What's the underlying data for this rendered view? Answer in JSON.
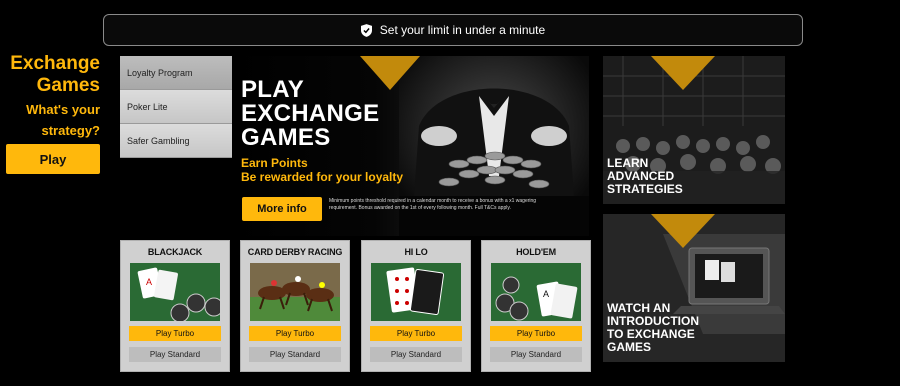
{
  "banner": {
    "text": "Set your limit in under a minute",
    "icon": "shield-check-icon"
  },
  "left": {
    "title_line1": "Exchange",
    "title_line2": "Games",
    "subtitle_line1": "What's your",
    "subtitle_line2": "strategy?",
    "play_label": "Play"
  },
  "menu": {
    "items": [
      {
        "label": "Loyalty Program"
      },
      {
        "label": "Poker Lite"
      },
      {
        "label": "Safer Gambling"
      }
    ]
  },
  "hero": {
    "title_line1": "PLAY",
    "title_line2": "EXCHANGE",
    "title_line3": "GAMES",
    "subtitle_line1": "Earn Points",
    "subtitle_line2": "Be rewarded for your loyalty",
    "button_label": "More info",
    "fine_print": "Minimum points threshold required in a calendar month to receive a bonus with a x1 wagering requirement. Bonus awarded on the 1st of every following month. Full T&Cs apply."
  },
  "side_cards": [
    {
      "label_line1": "LEARN",
      "label_line2": "ADVANCED",
      "label_line3": "STRATEGIES"
    },
    {
      "label_line1": "WATCH AN",
      "label_line2": "INTRODUCTION",
      "label_line3": "TO EXCHANGE",
      "label_line4": "GAMES"
    }
  ],
  "games": [
    {
      "title": "BLACKJACK",
      "turbo": "Play Turbo",
      "standard": "Play Standard"
    },
    {
      "title": "CARD DERBY RACING",
      "turbo": "Play Turbo",
      "standard": "Play Standard"
    },
    {
      "title": "HI LO",
      "turbo": "Play Turbo",
      "standard": "Play Standard"
    },
    {
      "title": "HOLD'EM",
      "turbo": "Play Turbo",
      "standard": "Play Standard"
    }
  ],
  "colors": {
    "accent": "#ffb80c",
    "background": "#000000",
    "card": "#d0d0d0"
  }
}
